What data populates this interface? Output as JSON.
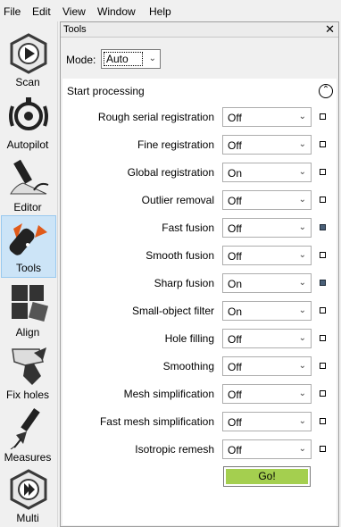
{
  "menubar": {
    "items": [
      "File",
      "Edit",
      "View",
      "Window",
      "Help"
    ]
  },
  "sidebar": {
    "items": [
      {
        "label": "Scan",
        "icon": "scan-icon",
        "active": false
      },
      {
        "label": "Autopilot",
        "icon": "autopilot-icon",
        "active": false
      },
      {
        "label": "Editor",
        "icon": "editor-icon",
        "active": false
      },
      {
        "label": "Tools",
        "icon": "tools-icon",
        "active": true
      },
      {
        "label": "Align",
        "icon": "align-icon",
        "active": false
      },
      {
        "label": "Fix holes",
        "icon": "fix-holes-icon",
        "active": false
      },
      {
        "label": "Measures",
        "icon": "measures-icon",
        "active": false
      },
      {
        "label": "Multi",
        "icon": "multi-icon",
        "active": false
      }
    ]
  },
  "panel": {
    "title": "Tools",
    "close": "✕",
    "mode_label": "Mode:",
    "mode_value": "Auto",
    "group_title": "Start processing",
    "rows": [
      {
        "label": "Rough serial registration",
        "value": "Off",
        "indicator_on": false
      },
      {
        "label": "Fine registration",
        "value": "Off",
        "indicator_on": false
      },
      {
        "label": "Global registration",
        "value": "On",
        "indicator_on": false
      },
      {
        "label": "Outlier removal",
        "value": "Off",
        "indicator_on": false
      },
      {
        "label": "Fast fusion",
        "value": "Off",
        "indicator_on": true
      },
      {
        "label": "Smooth fusion",
        "value": "Off",
        "indicator_on": false
      },
      {
        "label": "Sharp fusion",
        "value": "On",
        "indicator_on": true
      },
      {
        "label": "Small-object filter",
        "value": "On",
        "indicator_on": false
      },
      {
        "label": "Hole filling",
        "value": "Off",
        "indicator_on": false
      },
      {
        "label": "Smoothing",
        "value": "Off",
        "indicator_on": false
      },
      {
        "label": "Mesh simplification",
        "value": "Off",
        "indicator_on": false
      },
      {
        "label": "Fast mesh simplification",
        "value": "Off",
        "indicator_on": false
      },
      {
        "label": "Isotropic remesh",
        "value": "Off",
        "indicator_on": false
      }
    ],
    "go_label": "Go!"
  },
  "colors": {
    "active_tab_bg": "#cce4f7",
    "go_button": "#a4cf4f",
    "indicator_on": "#4a6078"
  }
}
